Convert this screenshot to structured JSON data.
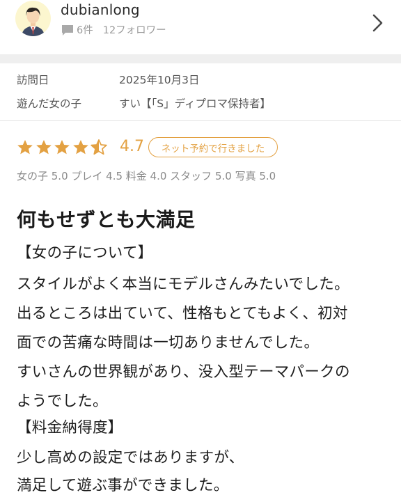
{
  "profile": {
    "username": "dubianlong",
    "reviews_count": "6件",
    "followers": "12フォロワー"
  },
  "visit": {
    "date_label": "訪問日",
    "date_value": "2025年10月3日",
    "girl_label": "遊んだ女の子",
    "girl_value": "すい【「S」ディプロマ保持者】"
  },
  "rating": {
    "stars": 4.5,
    "score": "4.7",
    "badge": "ネット予約で行きました",
    "subscores": "女の子 5.0 プレイ 4.5 料金 4.0 スタッフ 5.0 写真 5.0",
    "star_color": "#e3a142"
  },
  "review": {
    "title": "何もせずとも大満足",
    "lines": [
      "【女の子について】",
      "スタイルがよく本当にモデルさんみたいでした。",
      "出るところは出ていて、性格もとてもよく、初対",
      "面での苦痛な時間は一切ありませんでした。",
      "すいさんの世界観があり、没入型テーマパークの",
      "ようでした。",
      "【料金納得度】",
      "少し高めの設定ではありますが、",
      "満足して遊ぶ事ができました。"
    ]
  }
}
